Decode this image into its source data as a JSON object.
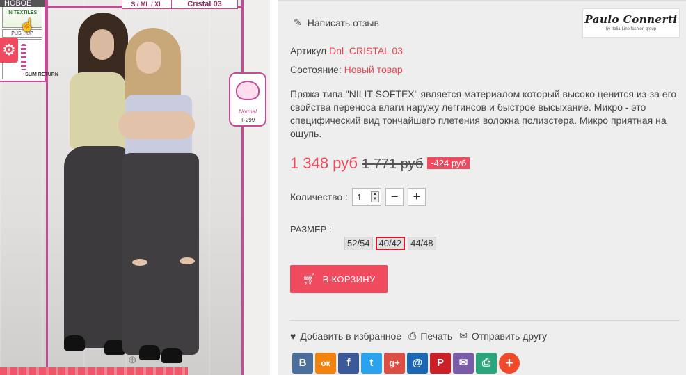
{
  "image_area": {
    "new_badge": "НОВОЕ",
    "size_tag": "S / ML / XL",
    "model_tag": "Cristal 03",
    "badges": {
      "eco_label": "IN TEXTILES",
      "push_up": "PUSH-UP",
      "slim_return": "SLIM RETURN"
    },
    "normal_badge": {
      "label": "Normal",
      "code": "T-299"
    }
  },
  "brand": {
    "name": "Paulo Connerti",
    "subtitle": "by Italia-Line fashion group"
  },
  "review": {
    "label": "Написать отзыв"
  },
  "sku": {
    "label": "Артикул",
    "value": "Dnl_CRISTAL 03"
  },
  "condition": {
    "label": "Состояние:",
    "value": "Новый товар"
  },
  "description": "Пряжа типа \"NILIT SOFTEX\" является материалом который высоко ценится из-за его свойства переноса влаги наружу леггинсов и быстрое высыхание. Микро - это специфический вид тончайшего плетения волокна полиэстера. Микро приятная на ощупь.",
  "price": {
    "current": "1 348 руб",
    "old": "1 771 руб",
    "discount": "-424 руб"
  },
  "quantity": {
    "label": "Количество :",
    "value": "1",
    "minus": "−",
    "plus": "+"
  },
  "size": {
    "label": "РАЗМЕР :",
    "options": [
      "52/54",
      "40/42",
      "44/48"
    ],
    "selected": "40/42"
  },
  "cart": {
    "label": "В КОРЗИНУ"
  },
  "actions": {
    "favorite": "Добавить в избранное",
    "print": "Печать",
    "send": "Отправить другу"
  },
  "social": [
    {
      "icon": "vk-icon",
      "glyph": "В",
      "color": "#4a6f9c"
    },
    {
      "icon": "odnoklassniki-icon",
      "glyph": "ок",
      "color": "#f2820b"
    },
    {
      "icon": "facebook-icon",
      "glyph": "f",
      "color": "#3b5998"
    },
    {
      "icon": "twitter-icon",
      "glyph": "t",
      "color": "#2aa3ef"
    },
    {
      "icon": "googleplus-icon",
      "glyph": "g+",
      "color": "#dc4e41"
    },
    {
      "icon": "mailru-icon",
      "glyph": "@",
      "color": "#1c67b3"
    },
    {
      "icon": "pinterest-icon",
      "glyph": "P",
      "color": "#cb2027"
    },
    {
      "icon": "email-icon",
      "glyph": "✉",
      "color": "#7a5ba8"
    },
    {
      "icon": "print-icon",
      "glyph": "⎙",
      "color": "#2aa57c"
    },
    {
      "icon": "more-icon",
      "glyph": "+",
      "color": "#f04a2a"
    }
  ],
  "colors": {
    "accent": "#f04a5e",
    "link": "#e8434f",
    "frame": "#c54b97"
  }
}
